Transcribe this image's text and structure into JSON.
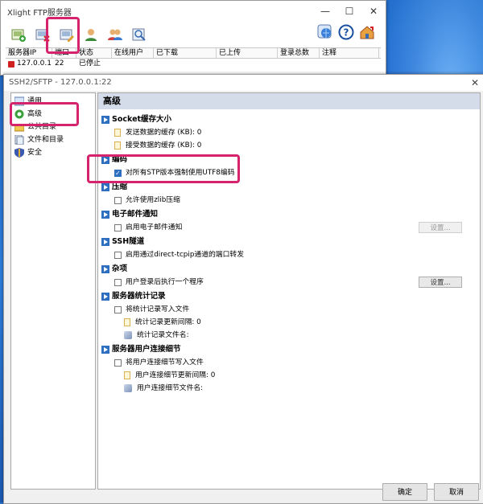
{
  "main_window": {
    "title": "Xlight FTP服务器",
    "controls": {
      "minimize": "—",
      "maximize": "☐",
      "close": "✕"
    },
    "toolbar": [
      {
        "name": "add-server-icon"
      },
      {
        "name": "delete-server-icon"
      },
      {
        "name": "edit-server-icon"
      },
      {
        "name": "user-icon"
      },
      {
        "name": "users-icon"
      },
      {
        "name": "view-log-icon"
      }
    ],
    "toolbar_right": [
      {
        "name": "globe-refresh-icon"
      },
      {
        "name": "help-icon"
      },
      {
        "name": "home-settings-icon"
      }
    ],
    "columns": [
      "服务器IP",
      "端口",
      "状态",
      "在线用户",
      "已下载",
      "已上传",
      "登录总数",
      "注释"
    ],
    "rows": [
      {
        "ip": "127.0.0.1",
        "port": "22",
        "status": "已停止"
      }
    ]
  },
  "dialog": {
    "title": "SSH2/SFTP - 127.0.0.1:22",
    "close": "✕",
    "nav": [
      {
        "label": "通用",
        "icon": "general-icon"
      },
      {
        "label": "高级",
        "icon": "advanced-icon"
      },
      {
        "label": "公共目录",
        "icon": "public-folder-icon"
      },
      {
        "label": "文件和目录",
        "icon": "files-dirs-icon"
      },
      {
        "label": "安全",
        "icon": "security-shield-icon"
      }
    ],
    "panel_title": "高级",
    "sections": {
      "socket": {
        "title": "Socket缓存大小",
        "send": "发送数据的缓存 (KB): 0",
        "recv": "接受数据的缓存 (KB): 0"
      },
      "encoding": {
        "title": "编码",
        "utf8": "对所有STP版本强制使用UTF8编码",
        "utf8_checked": true
      },
      "compress": {
        "title": "压缩",
        "zlib": "允许使用zlib压缩"
      },
      "email": {
        "title": "电子邮件通知",
        "enable": "启用电子邮件通知",
        "button": "设置..."
      },
      "ssh": {
        "title": "SSH隧道",
        "tcpip": "启用通过direct-tcpip通道的端口转发"
      },
      "misc": {
        "title": "杂项",
        "run": "用户登录后执行一个程序",
        "button": "设置..."
      },
      "stats": {
        "title": "服务器统计记录",
        "write": "将统计记录写入文件",
        "interval": "统计记录更新间隔: 0",
        "filename": "统计记录文件名:"
      },
      "conn": {
        "title": "服务器用户连接细节",
        "write": "将用户连接细节写入文件",
        "interval": "用户连接细节更新间隔: 0",
        "filename": "用户连接细节文件名:"
      }
    },
    "ok": "确定",
    "cancel": "取消"
  }
}
